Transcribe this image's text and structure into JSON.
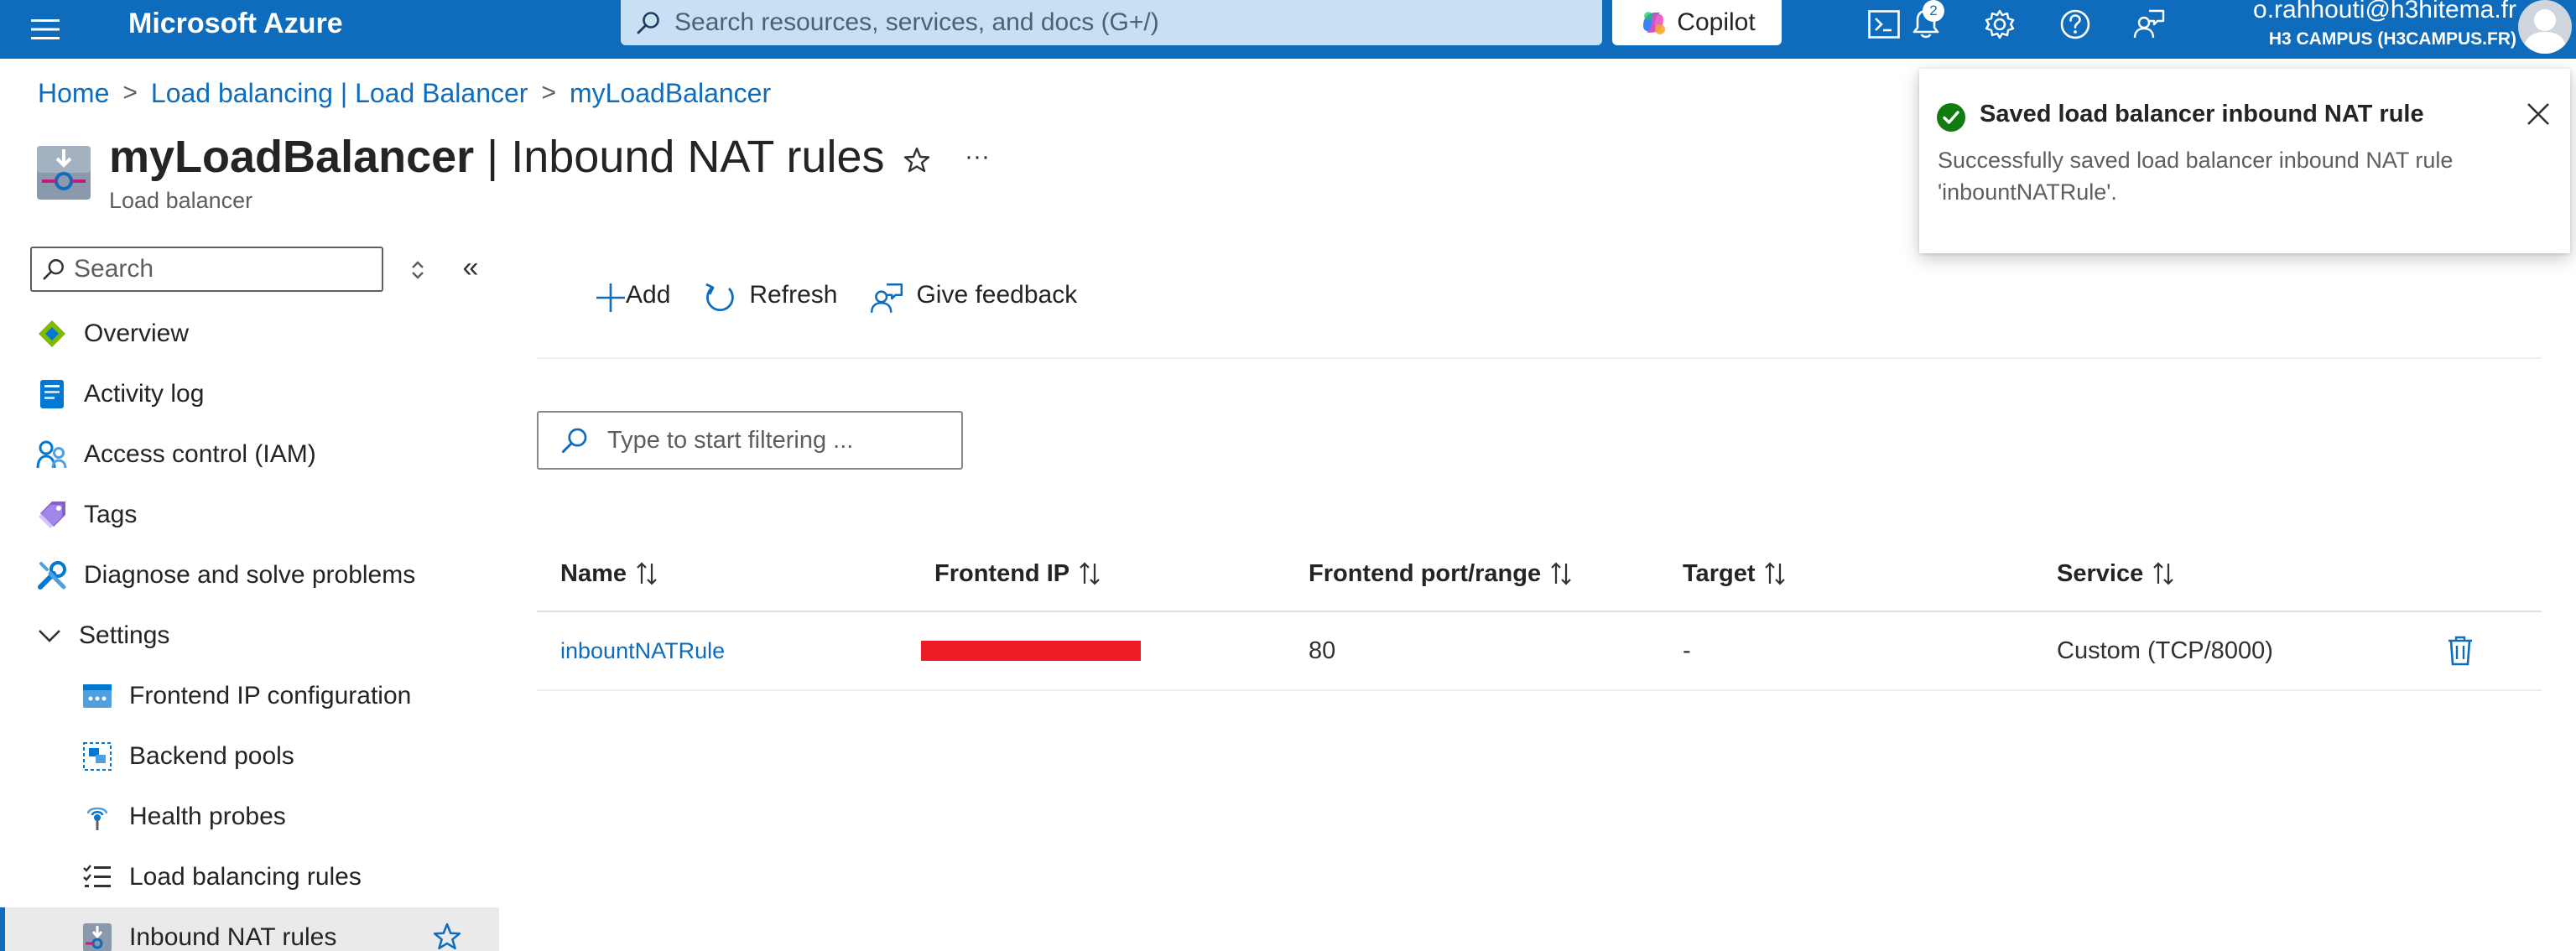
{
  "topbar": {
    "brand": "Microsoft Azure",
    "search_placeholder": "Search resources, services, and docs (G+/)",
    "copilot_label": "Copilot",
    "notification_count": "2",
    "account_email": "o.rahhouti@h3hitema.fr",
    "account_directory": "H3 CAMPUS (H3CAMPUS.FR)",
    "icons": [
      "hamburger-menu-icon",
      "search-icon",
      "copilot-icon",
      "cloud-shell-icon",
      "notifications-bell-icon",
      "settings-gear-icon",
      "help-icon",
      "feedback-icon",
      "avatar-icon"
    ]
  },
  "breadcrumb": {
    "items": [
      "Home",
      "Load balancing | Load Balancer",
      "myLoadBalancer"
    ]
  },
  "header": {
    "title_resource": "myLoadBalancer",
    "title_page": "Inbound NAT rules",
    "subtitle": "Load balancer",
    "more_label": "···"
  },
  "sidebar": {
    "search_placeholder": "Search",
    "collapse_label": "«",
    "items": [
      {
        "label": "Overview",
        "icon": "overview-icon"
      },
      {
        "label": "Activity log",
        "icon": "activity-log-icon"
      },
      {
        "label": "Access control (IAM)",
        "icon": "iam-icon"
      },
      {
        "label": "Tags",
        "icon": "tag-icon"
      },
      {
        "label": "Diagnose and solve problems",
        "icon": "wrench-icon"
      },
      {
        "label": "Settings",
        "icon": "chevron-down-icon"
      },
      {
        "label": "Frontend IP configuration",
        "icon": "frontend-ip-icon"
      },
      {
        "label": "Backend pools",
        "icon": "backend-pool-icon"
      },
      {
        "label": "Health probes",
        "icon": "health-probe-icon"
      },
      {
        "label": "Load balancing rules",
        "icon": "rules-list-icon"
      },
      {
        "label": "Inbound NAT rules",
        "icon": "inbound-nat-icon"
      }
    ]
  },
  "toolbar": {
    "add_label": "Add",
    "refresh_label": "Refresh",
    "feedback_label": "Give feedback"
  },
  "filter": {
    "placeholder": "Type to start filtering ..."
  },
  "grid": {
    "columns": [
      "Name",
      "Frontend IP",
      "Frontend port/range",
      "Target",
      "Service"
    ],
    "rows": [
      {
        "name": "inbountNATRule",
        "frontend_ip": "",
        "port": "80",
        "target": "-",
        "service": "Custom (TCP/8000)"
      }
    ]
  },
  "toast": {
    "title": "Saved load balancer inbound NAT rule",
    "message": "Successfully saved load balancer inbound NAT rule 'inbountNATRule'."
  },
  "colors": {
    "accent": "#0f6cbd",
    "success": "#107c10",
    "redaction": "#ee1c25"
  }
}
